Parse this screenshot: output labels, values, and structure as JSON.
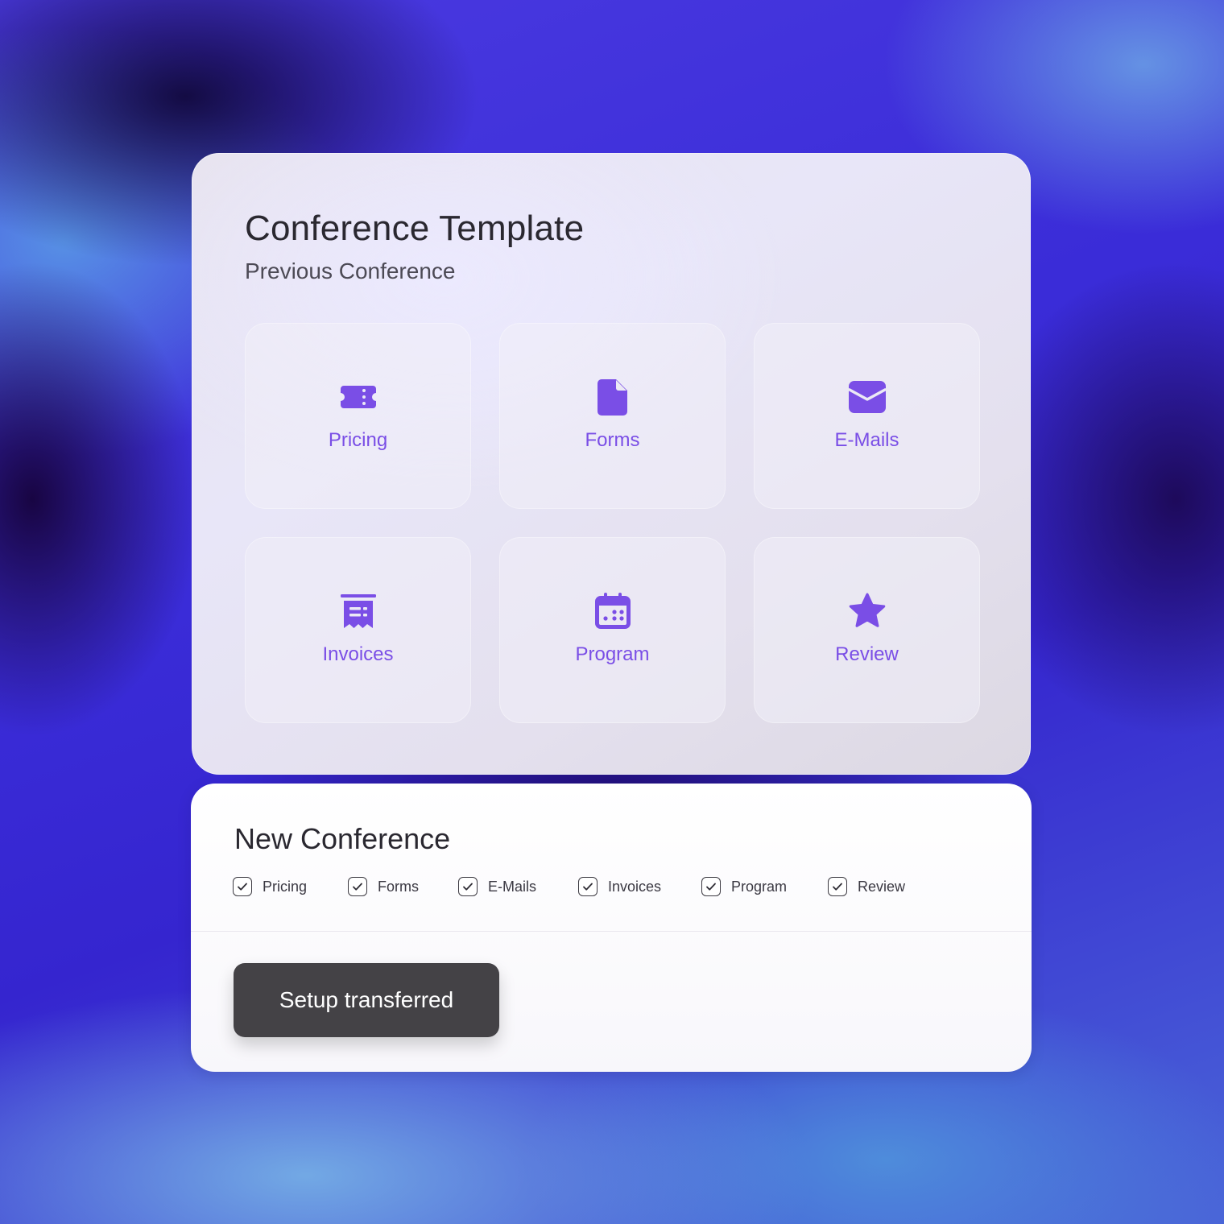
{
  "template": {
    "title": "Conference Template",
    "subtitle": "Previous Conference",
    "tiles": [
      {
        "label": "Pricing",
        "icon": "ticket-icon"
      },
      {
        "label": "Forms",
        "icon": "document-icon"
      },
      {
        "label": "E-Mails",
        "icon": "envelope-open-icon"
      },
      {
        "label": "Invoices",
        "icon": "receipt-icon"
      },
      {
        "label": "Program",
        "icon": "calendar-icon"
      },
      {
        "label": "Review",
        "icon": "star-icon"
      }
    ]
  },
  "new_conference": {
    "title": "New Conference",
    "checkboxes": [
      {
        "label": "Pricing",
        "checked": true
      },
      {
        "label": "Forms",
        "checked": true
      },
      {
        "label": "E-Mails",
        "checked": true
      },
      {
        "label": "Invoices",
        "checked": true
      },
      {
        "label": "Program",
        "checked": true
      },
      {
        "label": "Review",
        "checked": true
      }
    ],
    "button_label": "Setup transferred"
  },
  "colors": {
    "accent": "#7a4ee6",
    "icon": "#7a4ee6",
    "button_bg": "#444246",
    "text_dark": "#2a2830"
  }
}
